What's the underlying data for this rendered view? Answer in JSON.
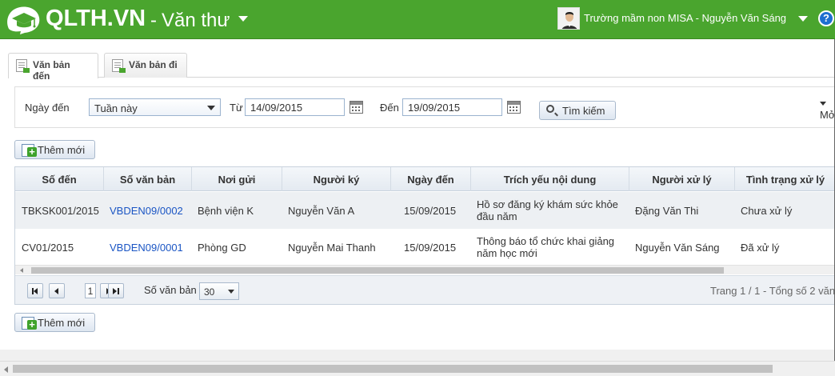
{
  "header": {
    "logo_text": "QLTH.VN",
    "module_dash": "-",
    "module_title": "Văn thư",
    "user_text": "Trường mầm non MISA - Nguyễn Văn Sáng",
    "help_label": "?"
  },
  "tabs": [
    {
      "label": "Văn bản đến",
      "active": true
    },
    {
      "label": "Văn bản đi",
      "active": false
    }
  ],
  "filter": {
    "date_label": "Ngày đến",
    "period_value": "Tuần này",
    "from_label": "Từ",
    "from_value": "14/09/2015",
    "to_label": "Đến",
    "to_value": "19/09/2015",
    "search_label": "Tìm kiếm",
    "more_label": "Mở"
  },
  "actions": {
    "add_label": "Thêm mới"
  },
  "grid": {
    "columns": [
      "Số đến",
      "Số văn bản",
      "Nơi gửi",
      "Người ký",
      "Ngày đến",
      "Trích yếu nội dung",
      "Người xử lý",
      "Tình trạng xử lý"
    ],
    "rows": [
      [
        "TBKSK001/2015",
        "VBDEN09/0002",
        "Bệnh viện K",
        "Nguyễn Văn A",
        "15/09/2015",
        "Hồ sơ đăng ký khám sức khỏe đầu năm",
        "Đặng Văn Thi",
        "Chưa xử lý"
      ],
      [
        "CV01/2015",
        "VBDEN09/0001",
        "Phòng GD",
        "Nguyễn Mai Thanh",
        "15/09/2015",
        "Thông báo tổ chức khai giảng năm học mới",
        "Nguyễn Văn Sáng",
        "Đã xử lý"
      ]
    ]
  },
  "pager": {
    "page_value": "1",
    "page_size_label": "Số văn bản",
    "page_size_value": "30",
    "info": "Trang 1 / 1 - Tổng số 2 văn"
  },
  "colors": {
    "header_green": "#4aa52e",
    "link_blue": "#1a55c4",
    "help_blue": "#1e6fd0"
  }
}
